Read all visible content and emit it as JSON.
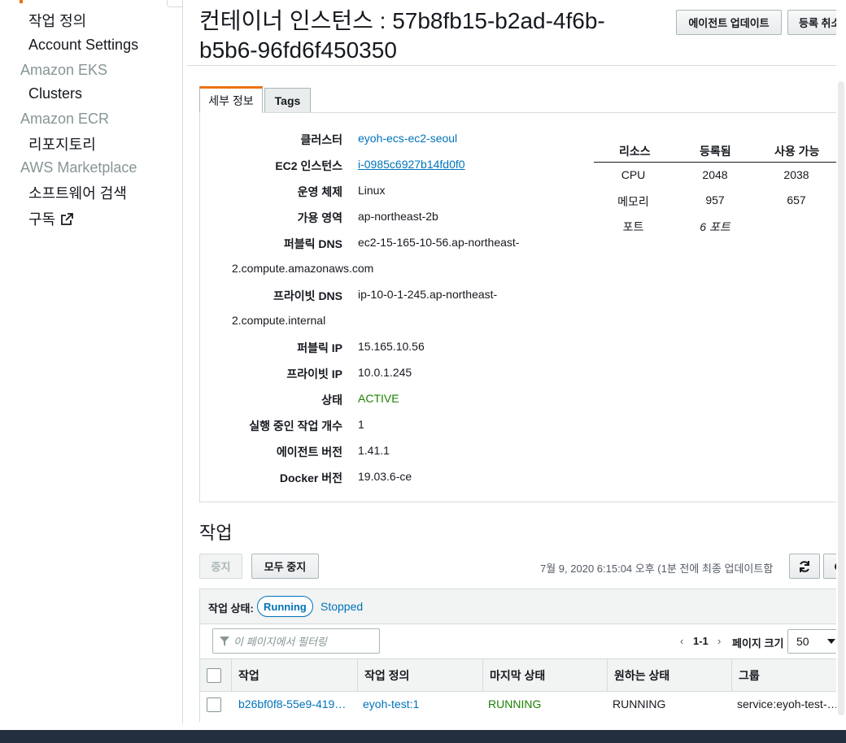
{
  "sidebar": {
    "items": [
      {
        "label": "작업 정의",
        "type": "item"
      },
      {
        "label": "Account Settings",
        "type": "item"
      },
      {
        "label": "Amazon EKS",
        "type": "heading"
      },
      {
        "label": "Clusters",
        "type": "item"
      },
      {
        "label": "Amazon ECR",
        "type": "heading"
      },
      {
        "label": "리포지토리",
        "type": "item"
      },
      {
        "label": "AWS Marketplace",
        "type": "heading"
      },
      {
        "label": "소프트웨어 검색",
        "type": "item"
      },
      {
        "label": "구독",
        "type": "item",
        "icon": "external-link-icon"
      }
    ]
  },
  "header": {
    "title": "컨테이너 인스턴스 : 57b8fb15-b2ad-4f6b-b5b6-96fd6f450350",
    "update_agent_label": "에이전트 업데이트",
    "deregister_label": "등록 취소"
  },
  "tabs": [
    {
      "label": "세부 정보",
      "active": true
    },
    {
      "label": "Tags",
      "active": false
    }
  ],
  "details": {
    "cluster_label": "클러스터",
    "cluster_value": "eyoh-ecs-ec2-seoul",
    "ec2_label": "EC2 인스턴스",
    "ec2_value": "i-0985c6927b14fd0f0",
    "os_label": "운영 체제",
    "os_value": "Linux",
    "az_label": "가용 영역",
    "az_value": "ap-northeast-2b",
    "public_dns_label": "퍼블릭 DNS",
    "public_dns_value_1": "ec2-15-165-10-56.ap-northeast-",
    "public_dns_value_2": "2.compute.amazonaws.com",
    "private_dns_label": "프라이빗 DNS",
    "private_dns_value_1": "ip-10-0-1-245.ap-northeast-",
    "private_dns_value_2": "2.compute.internal",
    "public_ip_label": "퍼블릭 IP",
    "public_ip_value": "15.165.10.56",
    "private_ip_label": "프라이빗 IP",
    "private_ip_value": "10.0.1.245",
    "status_label": "상태",
    "status_value": "ACTIVE",
    "running_tasks_label": "실행 중인 작업 개수",
    "running_tasks_value": "1",
    "agent_version_label": "에이전트 버전",
    "agent_version_value": "1.41.1",
    "docker_version_label": "Docker 버전",
    "docker_version_value": "19.03.6-ce"
  },
  "resources": {
    "headers": [
      "리소스",
      "등록됨",
      "사용 가능"
    ],
    "rows": [
      {
        "name": "CPU",
        "registered": "2048",
        "available": "2038"
      },
      {
        "name": "메모리",
        "registered": "957",
        "available": "657"
      },
      {
        "name": "포트",
        "registered": "6 포트",
        "available": ""
      }
    ]
  },
  "tasks": {
    "title": "작업",
    "stop_label": "중지",
    "stop_all_label": "모두 중지",
    "last_updated": "7월 9, 2020 6:15:04 오후 (1분 전에 최종 업데이트함",
    "status_filter_label": "작업 상태:",
    "running_label": "Running",
    "stopped_label": "Stopped",
    "filter_placeholder": "이 페이지에서 필터링",
    "pagination": "1-1",
    "page_size_label": "페이지 크기",
    "page_size_value": "50",
    "columns": [
      "작업",
      "작업 정의",
      "마지막 상태",
      "원하는 상태",
      "그룹"
    ],
    "rows": [
      {
        "task": "b26bf0f8-55e9-419…",
        "task_definition": "eyoh-test:1",
        "last_status": "RUNNING",
        "desired_status": "RUNNING",
        "group": "service:eyoh-test-s…"
      }
    ]
  },
  "colors": {
    "accent": "#ec7211",
    "link": "#0073bb",
    "success": "#1d8102"
  }
}
